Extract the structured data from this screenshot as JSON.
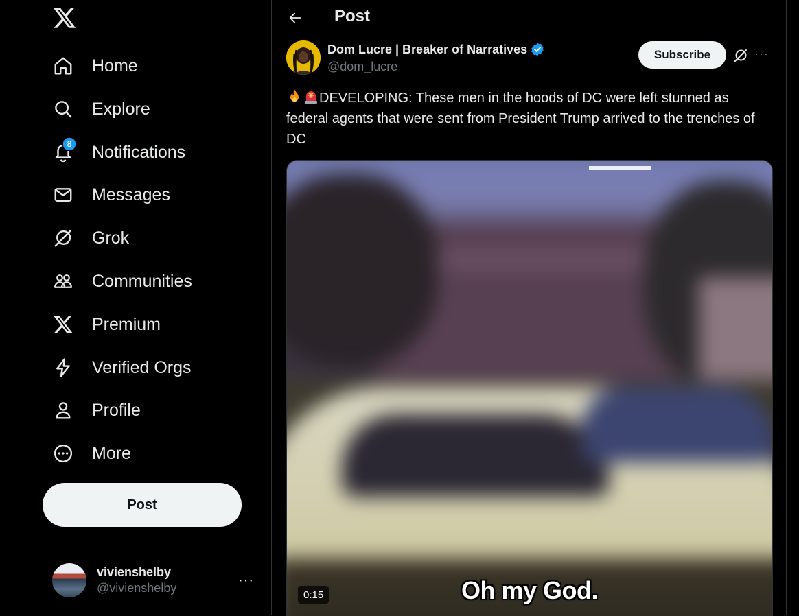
{
  "sidebar": {
    "logo": "x-logo-icon",
    "items": [
      {
        "label": "Home",
        "icon": "home-icon"
      },
      {
        "label": "Explore",
        "icon": "search-icon"
      },
      {
        "label": "Notifications",
        "icon": "bell-icon",
        "badge": "8"
      },
      {
        "label": "Messages",
        "icon": "mail-icon"
      },
      {
        "label": "Grok",
        "icon": "grok-icon"
      },
      {
        "label": "Communities",
        "icon": "people-icon"
      },
      {
        "label": "Premium",
        "icon": "x-logo-icon"
      },
      {
        "label": "Verified Orgs",
        "icon": "lightning-icon"
      },
      {
        "label": "Profile",
        "icon": "person-icon"
      },
      {
        "label": "More",
        "icon": "more-circle-icon"
      }
    ],
    "post_button": "Post",
    "account": {
      "name": "vivienshelby",
      "handle": "@vivienshelby",
      "more": "···"
    }
  },
  "main": {
    "title": "Post",
    "post": {
      "author_name": "Dom Lucre | Breaker of Narratives",
      "author_handle": "@dom_lucre",
      "subscribe_label": "Subscribe",
      "more": "···",
      "text": "DEVELOPING: These men in the hoods of DC were left stunned as federal agents that were sent from President Trump arrived to the trenches of DC",
      "video": {
        "duration": "0:15",
        "caption": "Oh my God."
      }
    }
  },
  "colors": {
    "background": "#000000",
    "text": "#e7e9ea",
    "muted": "#71767b",
    "accent": "#1d9bf0",
    "button_bg": "#eff3f4"
  }
}
